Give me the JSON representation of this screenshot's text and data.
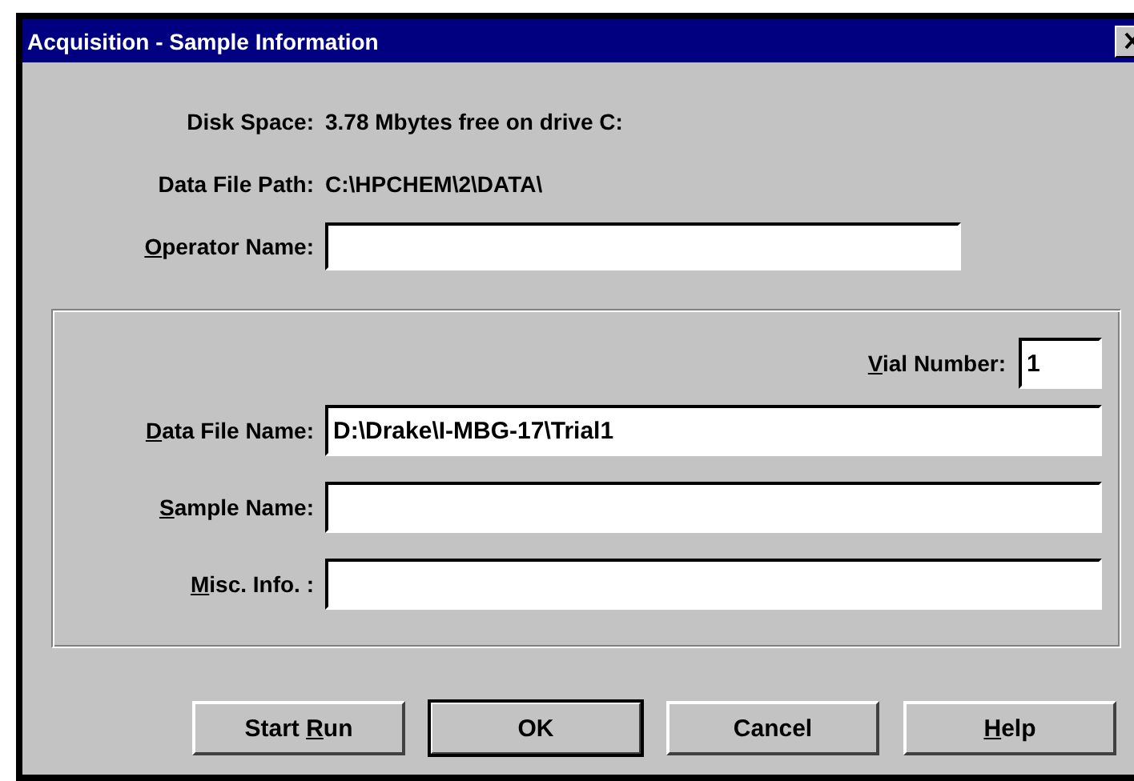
{
  "window": {
    "title": "Acquisition - Sample Information"
  },
  "info": [
    {
      "label": "Disk Space:",
      "value": "3.78 Mbytes free on drive C:"
    },
    {
      "label": "Data File Path:",
      "value": "C:\\HPCHEM\\2\\DATA\\"
    }
  ],
  "operator_field": {
    "label": {
      "key": "O",
      "post": "perator Name:"
    }
  },
  "sample_group": {
    "vial_number": {
      "label": {
        "key": "V",
        "post": "ial Number:"
      },
      "value": "1"
    },
    "fields": [
      {
        "label": {
          "key": "D",
          "post": "ata File Name:"
        },
        "value": "D:\\Drake\\I-MBG-17\\Trial1"
      },
      {
        "label": {
          "key": "S",
          "post": "ample Name:"
        }
      },
      {
        "label": {
          "key": "M",
          "post": "isc. Info. :"
        }
      }
    ]
  },
  "buttons": [
    {
      "label": {
        "pre": "Start ",
        "key": "R",
        "post": "un"
      },
      "default": false
    },
    {
      "label": {
        "pre": "OK"
      },
      "default": true
    },
    {
      "label": {
        "pre": "Cancel"
      },
      "default": false
    },
    {
      "label": {
        "key": "H",
        "post": "elp"
      },
      "default": false
    }
  ]
}
